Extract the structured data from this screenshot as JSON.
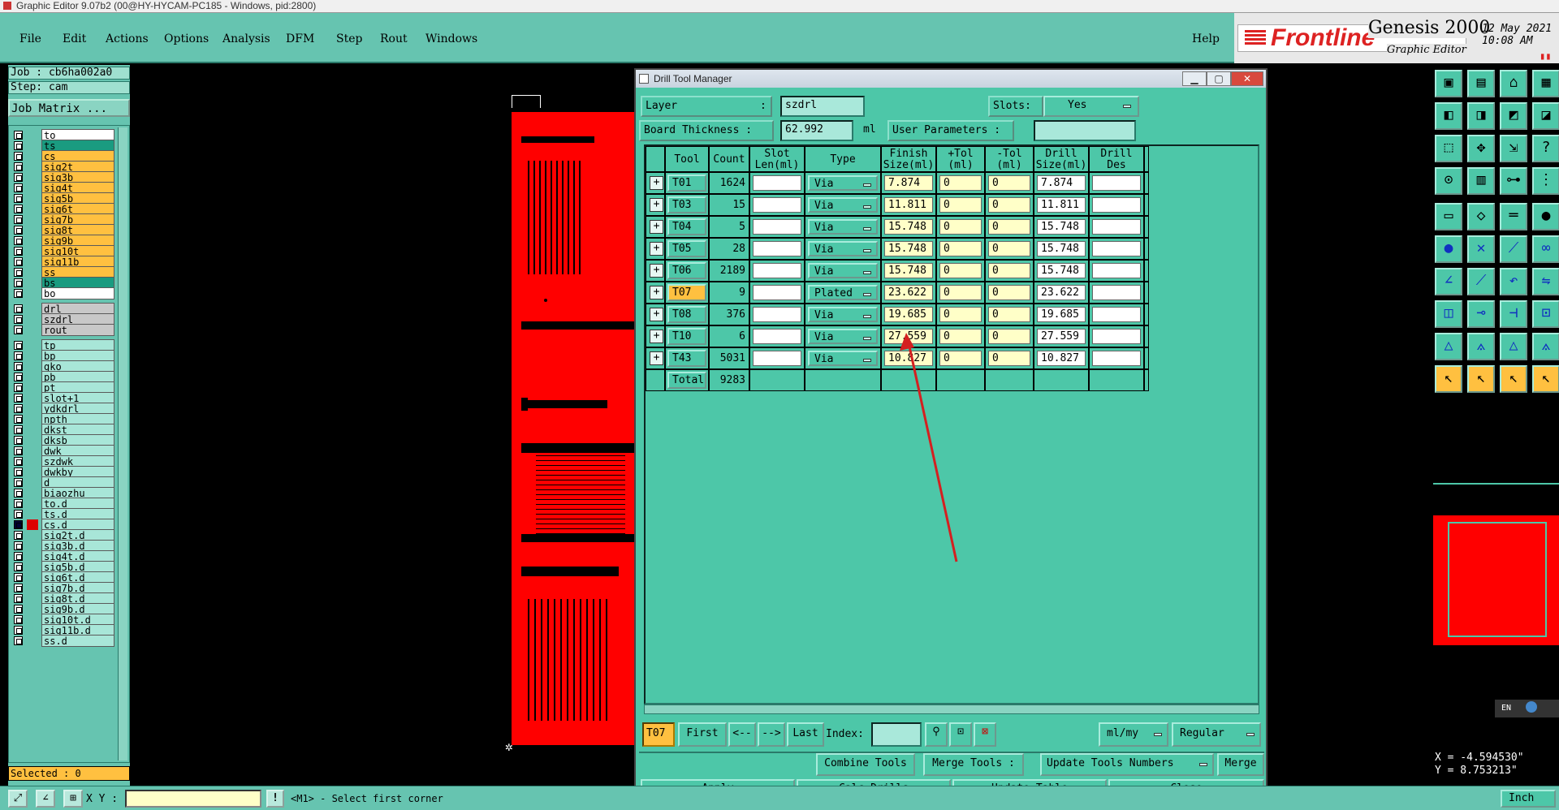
{
  "window": {
    "title": "Graphic Editor 9.07b2 (00@HY-HYCAM-PC185 - Windows, pid:2800)"
  },
  "menubar": {
    "items": [
      "File",
      "Edit",
      "Actions",
      "Options",
      "Analysis",
      "DFM",
      "Step",
      "Rout",
      "Windows"
    ],
    "help": "Help"
  },
  "brand": {
    "logo": "Frontline",
    "product": "Genesis 2000",
    "subtitle": "Graphic Editor",
    "date": "12 May 2021",
    "time": "10:08 AM"
  },
  "job": {
    "job_line": "Job : cb6ha002a0",
    "step_line": "Step: cam",
    "matrix_button": "Job Matrix ..."
  },
  "layers": {
    "group1": [
      {
        "name": "to",
        "style": "white"
      },
      {
        "name": "ts",
        "style": "teal"
      },
      {
        "name": "cs",
        "style": "orange"
      },
      {
        "name": "sig2t",
        "style": "orange"
      },
      {
        "name": "sig3b",
        "style": "orange"
      },
      {
        "name": "sig4t",
        "style": "orange"
      },
      {
        "name": "sig5b",
        "style": "orange"
      },
      {
        "name": "sig6t",
        "style": "orange"
      },
      {
        "name": "sig7b",
        "style": "orange"
      },
      {
        "name": "sig8t",
        "style": "orange"
      },
      {
        "name": "sig9b",
        "style": "orange"
      },
      {
        "name": "sig10t",
        "style": "orange"
      },
      {
        "name": "sig11b",
        "style": "orange"
      },
      {
        "name": "ss",
        "style": "orange"
      },
      {
        "name": "bs",
        "style": "teal"
      },
      {
        "name": "bo",
        "style": "white"
      }
    ],
    "group2": [
      {
        "name": "drl",
        "style": "gray"
      },
      {
        "name": "szdrl",
        "style": "gray"
      },
      {
        "name": "rout",
        "style": "gray"
      }
    ],
    "group3": [
      {
        "name": "tp"
      },
      {
        "name": "bp"
      },
      {
        "name": "gko"
      },
      {
        "name": "pb"
      },
      {
        "name": "pt"
      },
      {
        "name": "slot+1"
      },
      {
        "name": "ydkdrl"
      },
      {
        "name": "npth"
      },
      {
        "name": "dkst"
      },
      {
        "name": "dksb"
      },
      {
        "name": "dwk"
      },
      {
        "name": "szdwk"
      },
      {
        "name": "dwkby"
      },
      {
        "name": "d"
      },
      {
        "name": "biaozhu"
      },
      {
        "name": "to.d"
      },
      {
        "name": "ts.d"
      },
      {
        "name": "cs.d"
      },
      {
        "name": "sig2t.d"
      },
      {
        "name": "sig3b.d"
      },
      {
        "name": "sig4t.d"
      },
      {
        "name": "sig5b.d"
      },
      {
        "name": "sig6t.d"
      },
      {
        "name": "sig7b.d"
      },
      {
        "name": "sig8t.d"
      },
      {
        "name": "sig9b.d"
      },
      {
        "name": "sig10t.d"
      },
      {
        "name": "sig11b.d"
      },
      {
        "name": "ss.d"
      }
    ],
    "selected_label": "Selected : 0"
  },
  "dialog": {
    "title": "Drill Tool Manager",
    "layer_label": "Layer",
    "layer_colon": ":",
    "layer_value": "szdrl",
    "slots_label": "Slots:",
    "slots_value": "Yes",
    "thickness_label": "Board Thickness :",
    "thickness_value": "62.992",
    "thickness_unit": "ml",
    "user_params_label": "User Parameters :",
    "user_params_value": "",
    "columns": [
      "Tool",
      "Count",
      "Slot\nLen(ml)",
      "Type",
      "Finish\nSize(ml)",
      "+Tol\n(ml)",
      "-Tol\n(ml)",
      "Drill\nSize(ml)",
      "Drill\nDes"
    ],
    "rows": [
      {
        "tool": "T01",
        "count": "1624",
        "slot": "",
        "type": "Via",
        "finish": "7.874",
        "ptol": "0",
        "ntol": "0",
        "drill": "7.874",
        "des": ""
      },
      {
        "tool": "T03",
        "count": "15",
        "slot": "",
        "type": "Via",
        "finish": "11.811",
        "ptol": "0",
        "ntol": "0",
        "drill": "11.811",
        "des": ""
      },
      {
        "tool": "T04",
        "count": "5",
        "slot": "",
        "type": "Via",
        "finish": "15.748",
        "ptol": "0",
        "ntol": "0",
        "drill": "15.748",
        "des": ""
      },
      {
        "tool": "T05",
        "count": "28",
        "slot": "",
        "type": "Via",
        "finish": "15.748",
        "ptol": "0",
        "ntol": "0",
        "drill": "15.748",
        "des": ""
      },
      {
        "tool": "T06",
        "count": "2189",
        "slot": "",
        "type": "Via",
        "finish": "15.748",
        "ptol": "0",
        "ntol": "0",
        "drill": "15.748",
        "des": ""
      },
      {
        "tool": "T07",
        "count": "9",
        "slot": "",
        "type": "Plated",
        "finish": "23.622",
        "ptol": "0",
        "ntol": "0",
        "drill": "23.622",
        "des": "",
        "active": true
      },
      {
        "tool": "T08",
        "count": "376",
        "slot": "",
        "type": "Via",
        "finish": "19.685",
        "ptol": "0",
        "ntol": "0",
        "drill": "19.685",
        "des": ""
      },
      {
        "tool": "T10",
        "count": "6",
        "slot": "",
        "type": "Via",
        "finish": "27.559",
        "ptol": "0",
        "ntol": "0",
        "drill": "27.559",
        "des": ""
      },
      {
        "tool": "T43",
        "count": "5031",
        "slot": "",
        "type": "Via",
        "finish": "10.827",
        "ptol": "0",
        "ntol": "0",
        "drill": "10.827",
        "des": ""
      }
    ],
    "total_label": "Total",
    "total_count": "9283",
    "nav": {
      "current": "T07",
      "first": "First",
      "prev": "<--",
      "next": "-->",
      "last": "Last",
      "index_label": "Index:",
      "index_value": "",
      "units": "ml/my",
      "mode": "Regular"
    },
    "actions": {
      "combine": "Combine Tools",
      "merge_tools": "Merge Tools :",
      "update_numbers": "Update Tools Numbers",
      "merge": "Merge"
    },
    "footer": {
      "apply": "Apply",
      "calc": "Calc Drills",
      "update": "Update Table",
      "close": "Close"
    }
  },
  "bottom": {
    "xy_label": "X Y :",
    "xy_value": "",
    "status": "<M1> - Select first corner",
    "coord_x": "X = -4.594530\"",
    "coord_y": "Y = 8.753213\"",
    "units": "Inch",
    "lang": "EN"
  },
  "colors": {
    "panel": "#66c4b0",
    "dialog": "#4dc7a8",
    "active_tool": "#ffc040",
    "board": "#ff0000",
    "annotation_arrow": "#d42020"
  }
}
